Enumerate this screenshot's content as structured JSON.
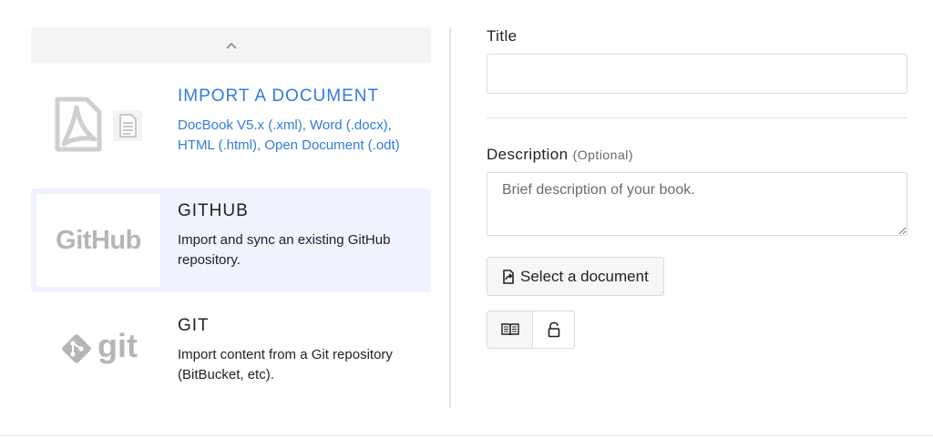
{
  "import_options": [
    {
      "id": "import-document",
      "title": "IMPORT A DOCUMENT",
      "description": "DocBook V5.x (.xml), Word (.docx), HTML (.html), Open Document (.odt)",
      "icons": [
        "pdf-icon",
        "document-icon"
      ],
      "highlighted": false,
      "color": "#2f7be0"
    },
    {
      "id": "github",
      "title": "GITHUB",
      "description": "Import and sync an existing GitHub repository.",
      "logo_text": "GitHub",
      "highlighted": true
    },
    {
      "id": "git",
      "title": "GIT",
      "description": "Import content from a Git repository (BitBucket, etc).",
      "logo_text": "git",
      "highlighted": false
    }
  ],
  "scroll_up_icon": "chevron-up-icon",
  "form": {
    "title_label": "Title",
    "title_value": "",
    "description_label": "Description",
    "description_optional": "(Optional)",
    "description_placeholder": "Brief description of your book.",
    "select_button_label": "Select a document",
    "select_button_icon": "share-icon",
    "toggle_icons": [
      "book-icon",
      "lock-icon"
    ]
  },
  "colors": {
    "accent": "#2f7be0",
    "highlight_bg": "#eef3fd",
    "logo_gray": "#b5b5b5"
  }
}
